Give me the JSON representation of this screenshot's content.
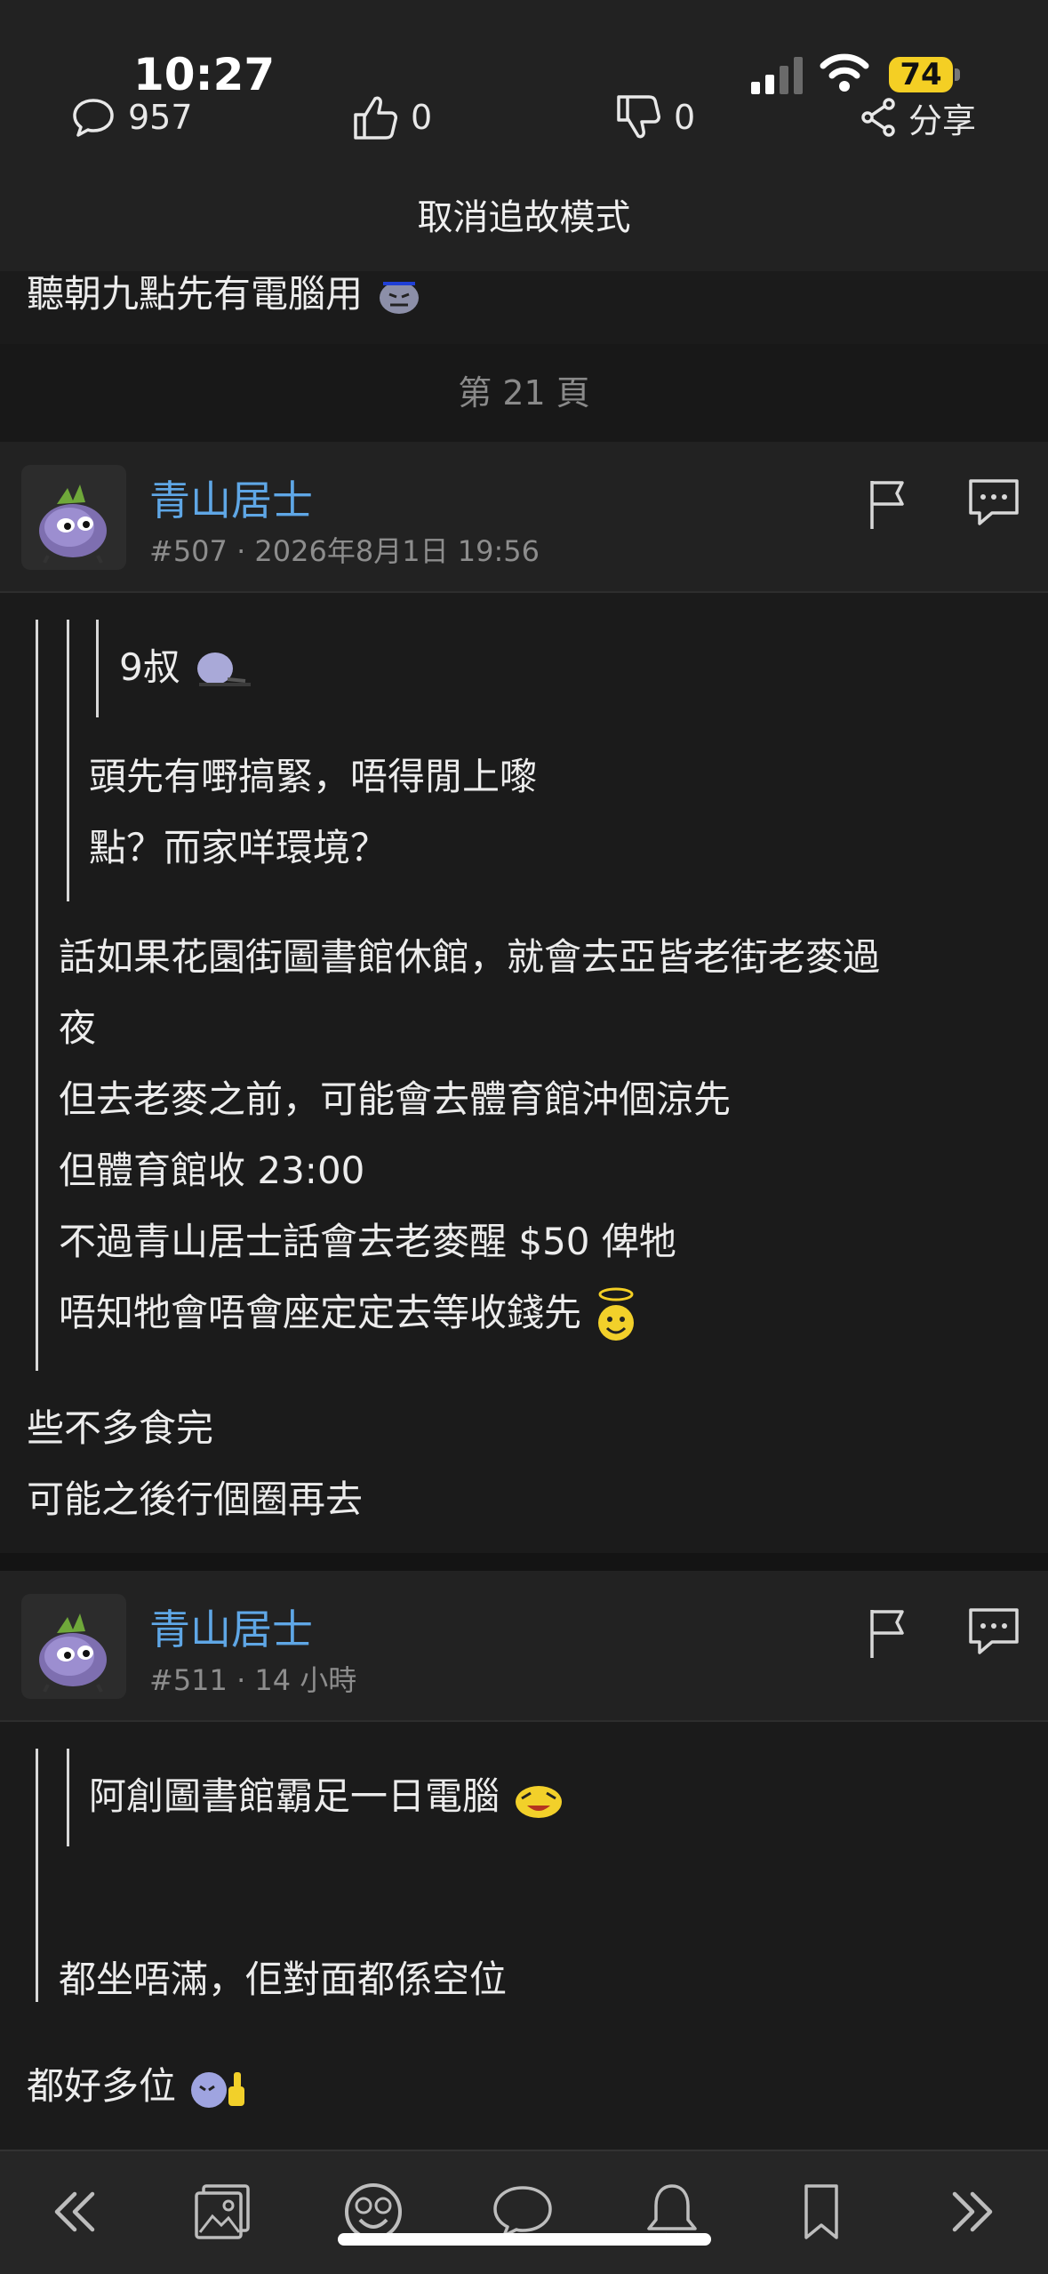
{
  "status": {
    "time": "10:27",
    "battery": "74"
  },
  "header": {
    "replies": "957",
    "likes": "0",
    "dislikes": "0",
    "share_label": "分享",
    "cancel_mode": "取消追故模式"
  },
  "prev_post_tail": "聽朝九點先有電腦用",
  "page_label": "第 21 頁",
  "posts": [
    {
      "username": "青山居士",
      "number": "#507",
      "time": "· 2026年8月1日 19:56",
      "quote_inner_author": "9叔",
      "quote_inner_lines": [
        "頭先有嘢搞緊，唔得閒上嚟",
        "點？而家咩環境？"
      ],
      "quote_lines": [
        "話如果花園街圖書館休館，就會去亞皆老街老麥過",
        "夜",
        "但去老麥之前，可能會去體育館沖個涼先",
        "但體育館收 23:00",
        "不過青山居士話會去老麥醒 $50 俾牠",
        "唔知牠會唔會座定定去等收錢先"
      ],
      "body_lines": [
        "些不多食完",
        "可能之後行個圈再去"
      ]
    },
    {
      "username": "青山居士",
      "number": "#511",
      "time": "· 14 小時",
      "quote_inner_lines": [
        "阿創圖書館霸足一日電腦"
      ],
      "quote_lines": [
        "都坐唔滿，佢對面都係空位"
      ],
      "body_lines": [
        "都好多位"
      ]
    }
  ],
  "colors": {
    "username": "#5fa7e6",
    "battery": "#f4cf24",
    "background": "#1b1b1b"
  },
  "bottom_nav": [
    "prev-page-icon",
    "image-icon",
    "money-emoji-icon",
    "comment-icon",
    "bell-icon",
    "bookmark-icon",
    "next-page-icon"
  ]
}
